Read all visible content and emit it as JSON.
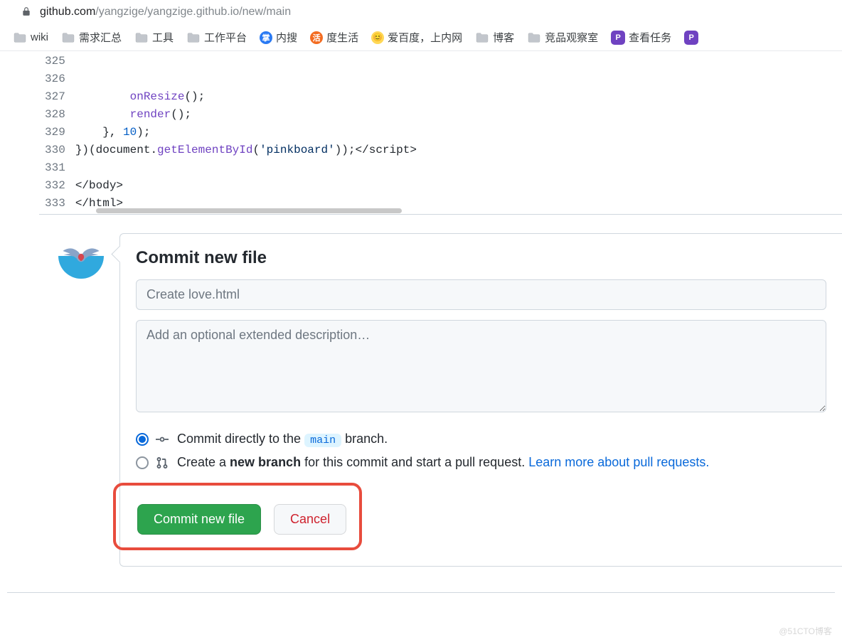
{
  "url": {
    "host": "github.com",
    "path": "/yangzige/yangzige.github.io/new/main"
  },
  "bookmarks": [
    {
      "type": "folder",
      "label": "wiki"
    },
    {
      "type": "folder",
      "label": "需求汇总"
    },
    {
      "type": "folder",
      "label": "工具"
    },
    {
      "type": "folder",
      "label": "工作平台"
    },
    {
      "type": "icon",
      "style": "blue",
      "glyph": "掌",
      "label": "内搜"
    },
    {
      "type": "icon",
      "style": "orange",
      "glyph": "活",
      "label": "度生活"
    },
    {
      "type": "icon",
      "style": "yellow",
      "glyph": "😊",
      "label": "爱百度，上内网"
    },
    {
      "type": "folder",
      "label": "博客"
    },
    {
      "type": "folder",
      "label": "竞品观察室"
    },
    {
      "type": "icon",
      "style": "purple",
      "glyph": "P",
      "label": "查看任务"
    },
    {
      "type": "icon",
      "style": "purple",
      "glyph": "P",
      "label": ""
    }
  ],
  "code": {
    "lines": [
      {
        "n": 325,
        "raw": ""
      },
      {
        "n": 326,
        "raw": ""
      },
      {
        "n": 327,
        "raw": "        onResize();"
      },
      {
        "n": 328,
        "raw": "        render();"
      },
      {
        "n": 329,
        "raw": "    }, 10);"
      },
      {
        "n": 330,
        "raw": "})(document.getElementById('pinkboard'));</script"
      },
      {
        "n": 331,
        "raw": ""
      },
      {
        "n": 332,
        "raw": "</body>"
      },
      {
        "n": 333,
        "raw": "</html>"
      }
    ]
  },
  "commit": {
    "heading": "Commit new file",
    "summary_placeholder": "Create love.html",
    "description_placeholder": "Add an optional extended description…",
    "option_direct_before": "Commit directly to the ",
    "option_direct_branch": "main",
    "option_direct_after": " branch.",
    "option_branch_before": "Create a ",
    "option_branch_bold": "new branch",
    "option_branch_after": " for this commit and start a pull request. ",
    "option_branch_link": "Learn more about pull requests.",
    "btn_commit": "Commit new file",
    "btn_cancel": "Cancel"
  },
  "watermark": "@51CTO博客"
}
